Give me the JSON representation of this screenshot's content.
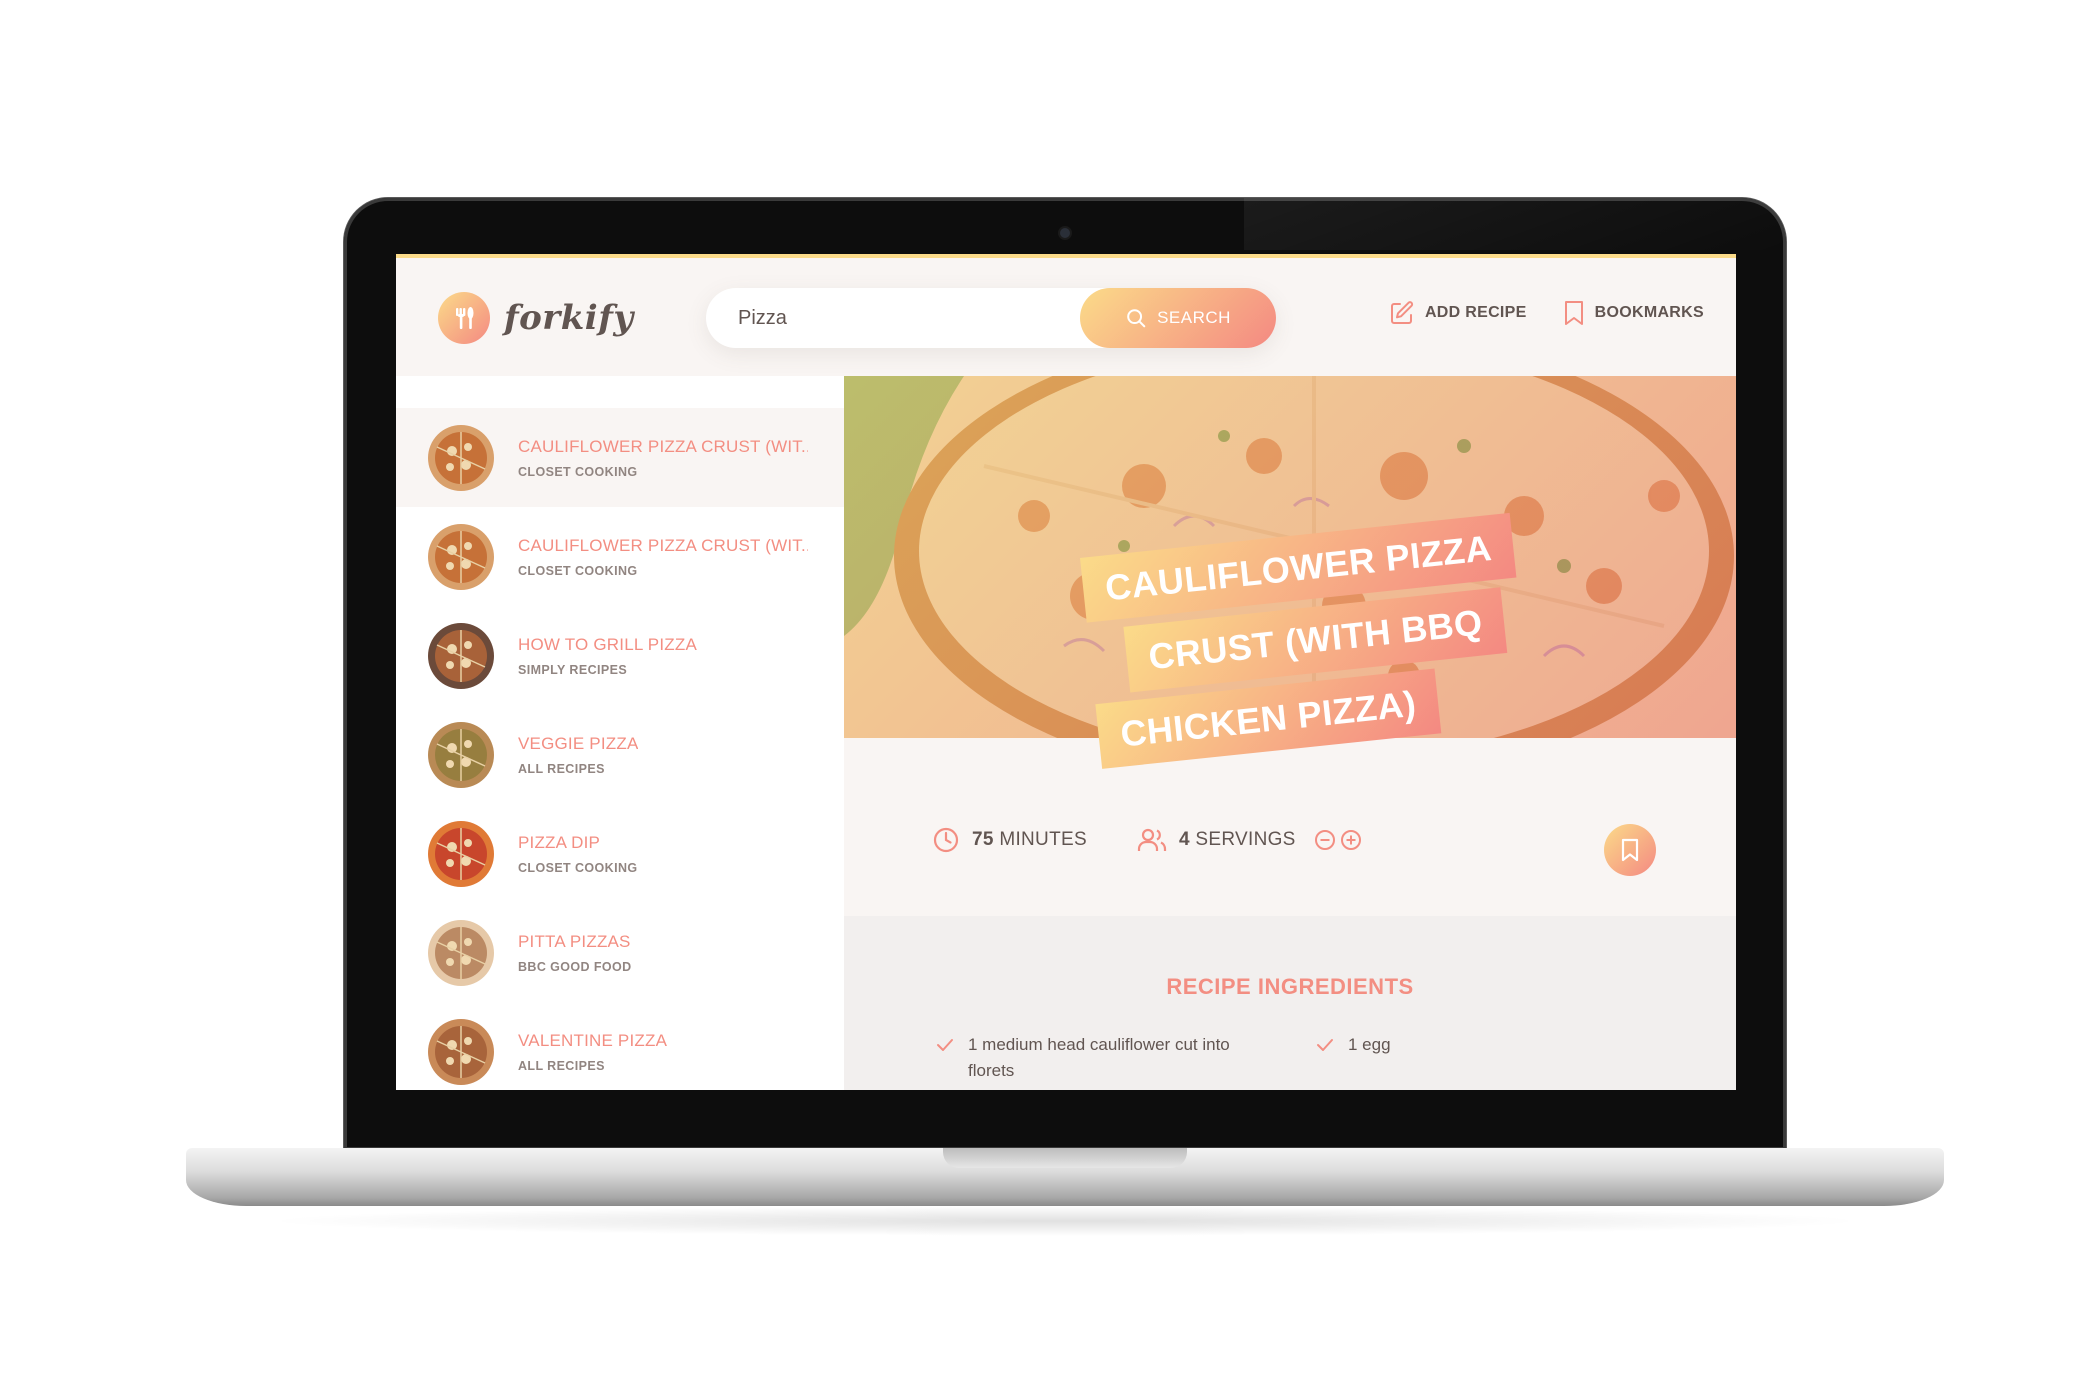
{
  "header": {
    "logo_text": "forkify",
    "search": {
      "value": "Pizza",
      "button_label": "SEARCH"
    },
    "nav": {
      "add_recipe": "ADD RECIPE",
      "bookmarks": "BOOKMARKS"
    }
  },
  "results": [
    {
      "title": "CAULIFLOWER PIZZA CRUST (WIT...",
      "publisher": "CLOSET COOKING",
      "active": true,
      "icon": "pizza-thumb"
    },
    {
      "title": "CAULIFLOWER PIZZA CRUST (WIT...",
      "publisher": "CLOSET COOKING",
      "active": false,
      "icon": "pizza-thumb"
    },
    {
      "title": "HOW TO GRILL PIZZA",
      "publisher": "SIMPLY RECIPES",
      "active": false,
      "icon": "pizza-thumb"
    },
    {
      "title": "VEGGIE PIZZA",
      "publisher": "ALL RECIPES",
      "active": false,
      "icon": "pizza-thumb"
    },
    {
      "title": "PIZZA DIP",
      "publisher": "CLOSET COOKING",
      "active": false,
      "icon": "pizza-thumb"
    },
    {
      "title": "PITTA PIZZAS",
      "publisher": "BBC GOOD FOOD",
      "active": false,
      "icon": "pizza-thumb"
    },
    {
      "title": "VALENTINE PIZZA",
      "publisher": "ALL RECIPES",
      "active": false,
      "icon": "pizza-thumb"
    }
  ],
  "recipe": {
    "title_lines": [
      "CAULIFLOWER PIZZA",
      "CRUST (WITH BBQ",
      "CHICKEN PIZZA)"
    ],
    "minutes": "75",
    "minutes_label": "MINUTES",
    "servings": "4",
    "servings_label": "SERVINGS",
    "ingredients_heading": "RECIPE INGREDIENTS",
    "ingredients": [
      {
        "text": "1 medium head cauliflower cut into florets"
      },
      {
        "text": "1 egg"
      }
    ]
  },
  "colors": {
    "accent_start": "#fbdb89",
    "accent_end": "#f48982",
    "text": "#615551",
    "title_orange": "#f38e82"
  }
}
